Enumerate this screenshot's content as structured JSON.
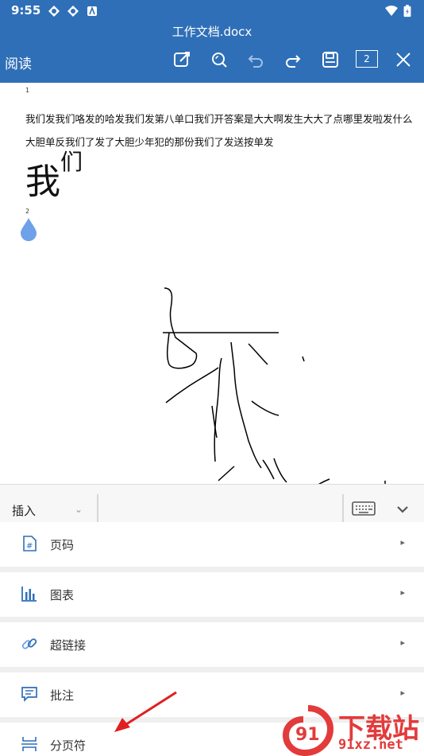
{
  "status_bar": {
    "time": "9:55"
  },
  "header": {
    "doc_title": "工作文档.docx",
    "mode_label": "阅读",
    "page_count": "2"
  },
  "document": {
    "page1_number": "1",
    "line1": "我们发我们咯发的哈发我们发第八单口我们开答案是大大啊发生大大了点哪里发啦发什么",
    "line2": "大胆单反我们了发了大胆少年犯的那份我们了发送按单发",
    "big_text_main": "我",
    "big_text_super": "们",
    "page2_number": "2"
  },
  "panel": {
    "insert_combo": "插入",
    "items": [
      {
        "label": "页码",
        "icon": "page-number-icon"
      },
      {
        "label": "图表",
        "icon": "chart-icon"
      },
      {
        "label": "超链接",
        "icon": "link-icon"
      },
      {
        "label": "批注",
        "icon": "comment-icon"
      },
      {
        "label": "分页符",
        "icon": "page-break-icon"
      }
    ]
  },
  "watermark": {
    "text1": "下载站",
    "text2": "91xz.net"
  },
  "colors": {
    "header": "#2f6fb7",
    "accent": "#3f7bd6",
    "annotation_arrow": "#e02020",
    "watermark": "#e23b3b"
  }
}
